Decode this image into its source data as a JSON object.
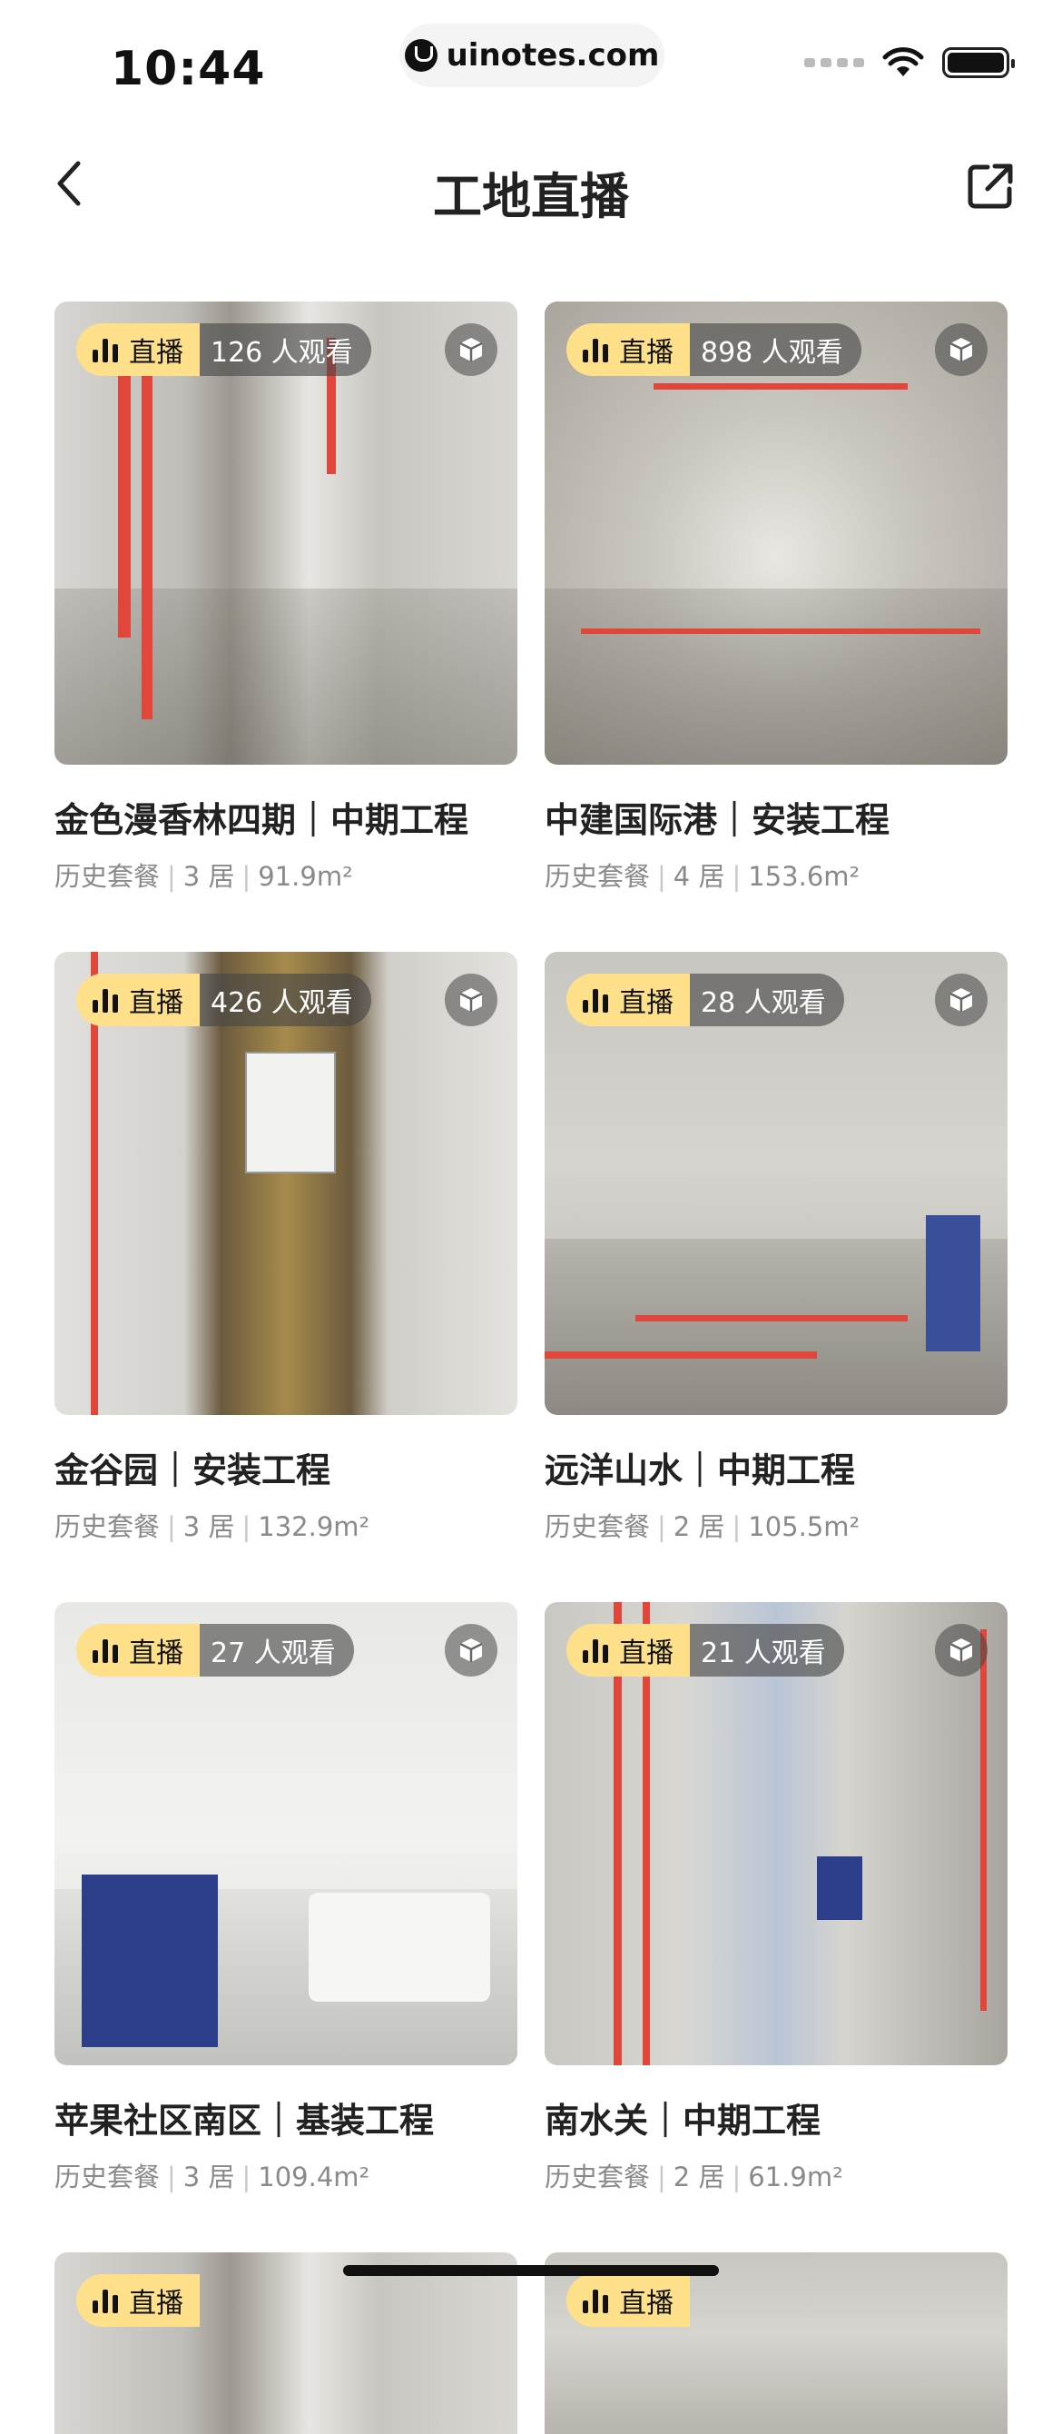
{
  "status_bar": {
    "time": "10:44",
    "url": "uinotes.com"
  },
  "nav": {
    "title": "工地直播"
  },
  "live_label": "直播",
  "cards": [
    {
      "viewers": "126 人观看",
      "title": "金色漫香林四期｜中期工程",
      "package": "历史套餐",
      "rooms": "3 居",
      "area": "91.9m²"
    },
    {
      "viewers": "898 人观看",
      "title": "中建国际港｜安装工程",
      "package": "历史套餐",
      "rooms": "4 居",
      "area": "153.6m²"
    },
    {
      "viewers": "426 人观看",
      "title": "金谷园｜安装工程",
      "package": "历史套餐",
      "rooms": "3 居",
      "area": "132.9m²"
    },
    {
      "viewers": "28 人观看",
      "title": "远洋山水｜中期工程",
      "package": "历史套餐",
      "rooms": "2 居",
      "area": "105.5m²"
    },
    {
      "viewers": "27 人观看",
      "title": "苹果社区南区｜基装工程",
      "package": "历史套餐",
      "rooms": "3 居",
      "area": "109.4m²"
    },
    {
      "viewers": "21 人观看",
      "title": "南水关｜中期工程",
      "package": "历史套餐",
      "rooms": "2 居",
      "area": "61.9m²"
    }
  ]
}
